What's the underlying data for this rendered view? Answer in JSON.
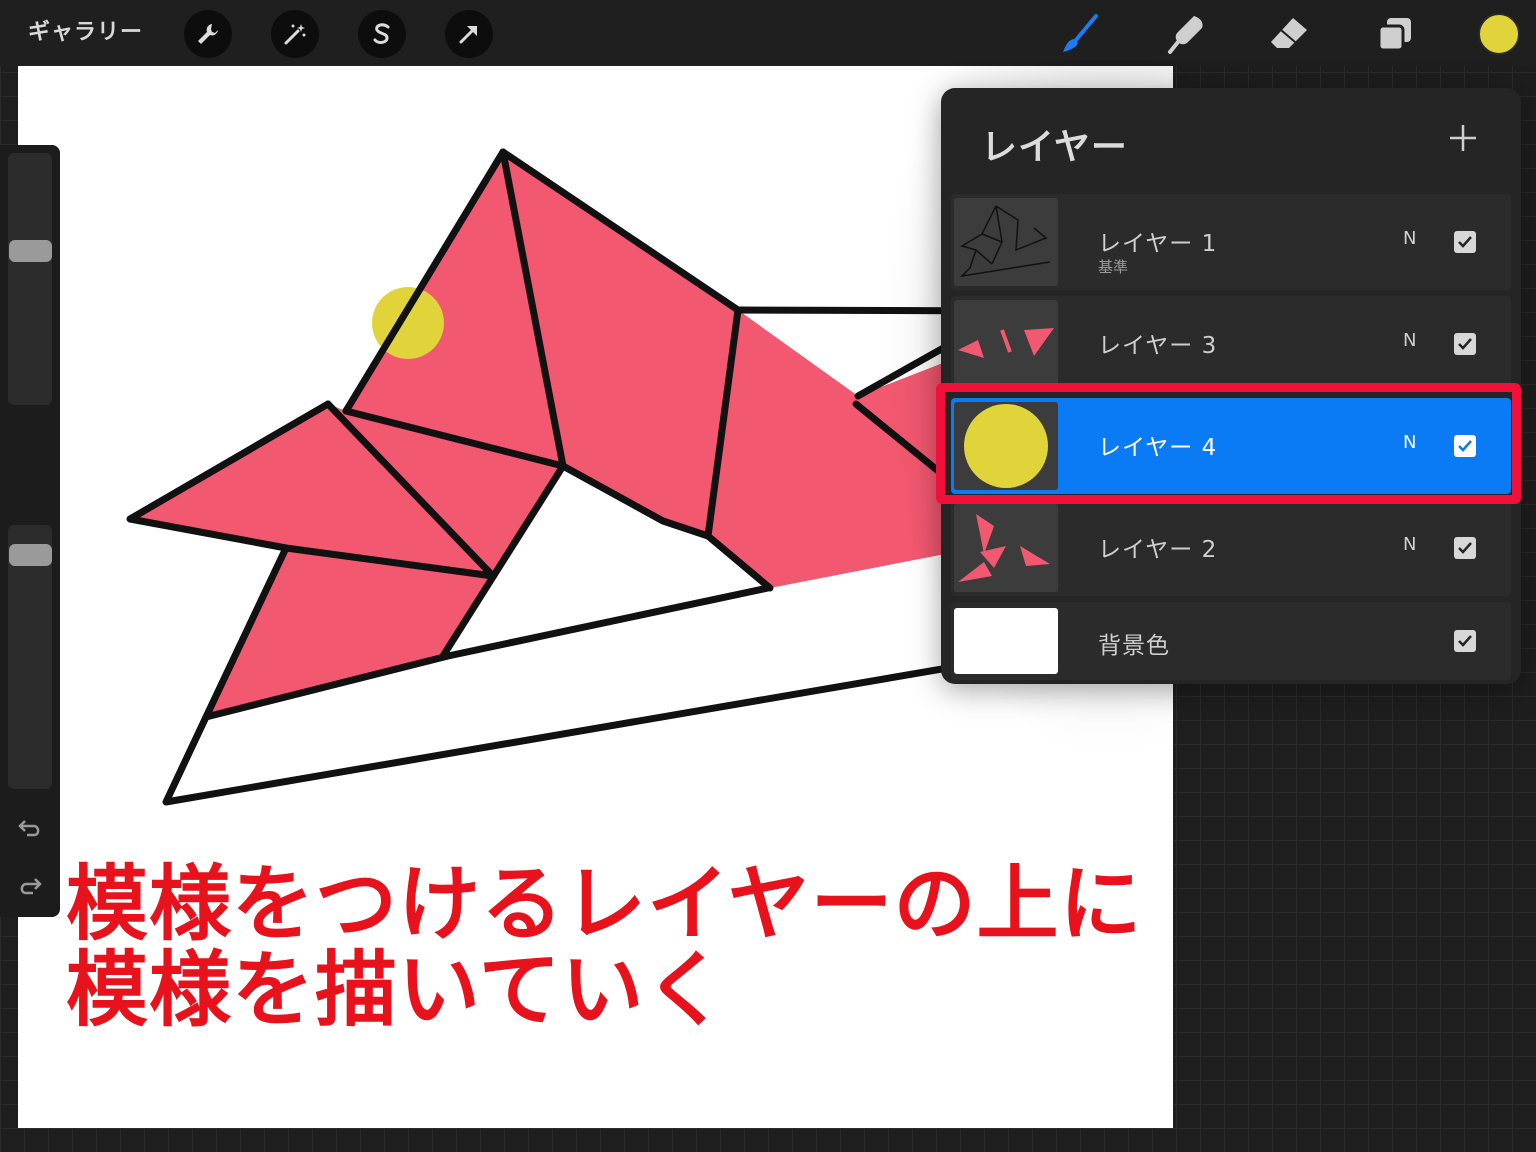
{
  "toolbar": {
    "gallery_label": "ギャラリー",
    "left_tools": [
      "wrench-icon",
      "magic-wand-icon",
      "selection-s-icon",
      "move-arrow-icon"
    ],
    "right_tools": [
      "brush-icon",
      "smudge-icon",
      "eraser-icon",
      "layers-icon"
    ],
    "active_tool": "brush-icon",
    "current_color": "#e0d43a",
    "active_tool_color": "#1e7bf0"
  },
  "canvas": {
    "caption_lines": [
      "模様をつけるレイヤーの上に",
      "模様を描いていく"
    ],
    "caption_color": "#e8121c",
    "fill_color": "#f25870",
    "dot_color": "#e0d43a"
  },
  "layers_panel": {
    "title": "レイヤー",
    "add_icon": "plus-icon",
    "layers": [
      {
        "name": "レイヤー 1",
        "sublabel": "基準",
        "blend": "N",
        "visible": true,
        "selected": false
      },
      {
        "name": "レイヤー 3",
        "sublabel": "",
        "blend": "N",
        "visible": true,
        "selected": false
      },
      {
        "name": "レイヤー 4",
        "sublabel": "",
        "blend": "N",
        "visible": true,
        "selected": true
      },
      {
        "name": "レイヤー 2",
        "sublabel": "",
        "blend": "N",
        "visible": true,
        "selected": false
      },
      {
        "name": "背景色",
        "sublabel": "",
        "blend": "",
        "visible": true,
        "selected": false
      }
    ],
    "selected_color": "#0a7bf5",
    "highlight_color": "#f0103a"
  },
  "sidebar": {
    "brush_size_level": 0.62,
    "opacity_level": 0.92,
    "undo_icon": "undo-icon",
    "redo_icon": "redo-icon"
  }
}
